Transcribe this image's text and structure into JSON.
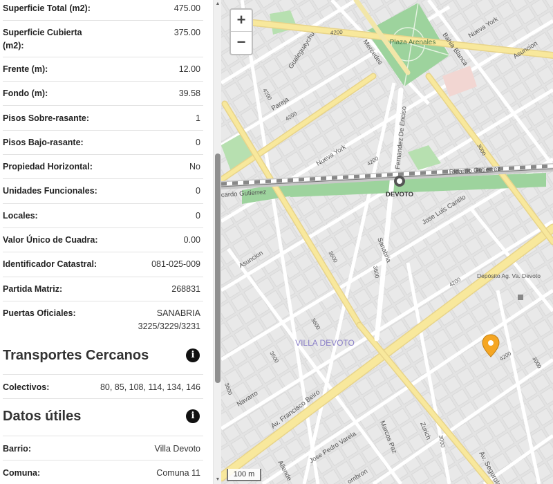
{
  "details": {
    "rows": [
      {
        "label": "Superficie Total (m2):",
        "value": "475.00"
      },
      {
        "label": "Superficie Cubierta (m2):",
        "value": "375.00"
      },
      {
        "label": "Frente (m):",
        "value": "12.00"
      },
      {
        "label": "Fondo (m):",
        "value": "39.58"
      },
      {
        "label": "Pisos Sobre-rasante:",
        "value": "1"
      },
      {
        "label": "Pisos Bajo-rasante:",
        "value": "0"
      },
      {
        "label": "Propiedad Horizontal:",
        "value": "No"
      },
      {
        "label": "Unidades Funcionales:",
        "value": "0"
      },
      {
        "label": "Locales:",
        "value": "0"
      },
      {
        "label": "Valor Único de Cuadra:",
        "value": "0.00"
      },
      {
        "label": "Identificador Catastral:",
        "value": "081-025-009"
      },
      {
        "label": "Partida Matriz:",
        "value": "268831"
      },
      {
        "label": "Puertas Oficiales:",
        "value": "SANABRIA 3225/3229/3231"
      }
    ]
  },
  "transportes": {
    "title": "Transportes Cercanos",
    "info_icon": "info-icon",
    "rows": [
      {
        "label": "Colectivos:",
        "value": "80, 85, 108, 114, 134, 146"
      }
    ]
  },
  "datos": {
    "title": "Datos útiles",
    "info_icon": "info-icon",
    "rows": [
      {
        "label": "Barrio:",
        "value": "Villa Devoto"
      },
      {
        "label": "Comuna:",
        "value": "Comuna 11"
      }
    ]
  },
  "map": {
    "zoom_in": "+",
    "zoom_out": "−",
    "scale": "100 m",
    "marker_color": "#f5a623",
    "labels": {
      "plaza": "Plaza Arenales",
      "station": "DEVOTO",
      "neighborhood": "VILLA DEVOTO",
      "deposito": "Depósito Ag. Va. Devoto",
      "s_gualeguaychu": "Gualeguaychu",
      "s_mercedes": "Mercedes",
      "s_bahia": "Bahia Blanca",
      "s_nueva_york_top": "Nueva York",
      "s_asuncion_top": "Asuncion",
      "s_pareja": "Pareja",
      "s_fernandez": "Fernandez De Enciso",
      "s_nueva_york": "Nueva York",
      "s_ricardo_r": "Ricardo Gutierrez",
      "s_ricardo_l": "cardo Gutierrez",
      "s_jose_luis": "Jose Luis Cantilo",
      "s_sanabria": "Sanabria",
      "s_asuncion": "Asuncion",
      "s_navarro": "Navarro",
      "s_beiro": "Av. Francisco Beiro",
      "s_varela": "Jose Pedro Varela",
      "s_marcos": "Marcos Paz",
      "s_zurich": "Zurich",
      "s_segurola": "Av. Segurola",
      "s_allende": "Allende",
      "s_lombron": "ombron",
      "n_4200a": "4200",
      "n_4200b": "4200",
      "n_4200c": "4200",
      "n_4200d": "4200",
      "n_4200e": "4200",
      "n_4200f": "4200",
      "n_3600a": "3600",
      "n_3600b": "3600",
      "n_3600c": "3600",
      "n_3600d": "3600",
      "n_3600e": "3600",
      "n_3000a": "3000",
      "n_3000b": "3000",
      "n_3000c": "3000"
    }
  }
}
